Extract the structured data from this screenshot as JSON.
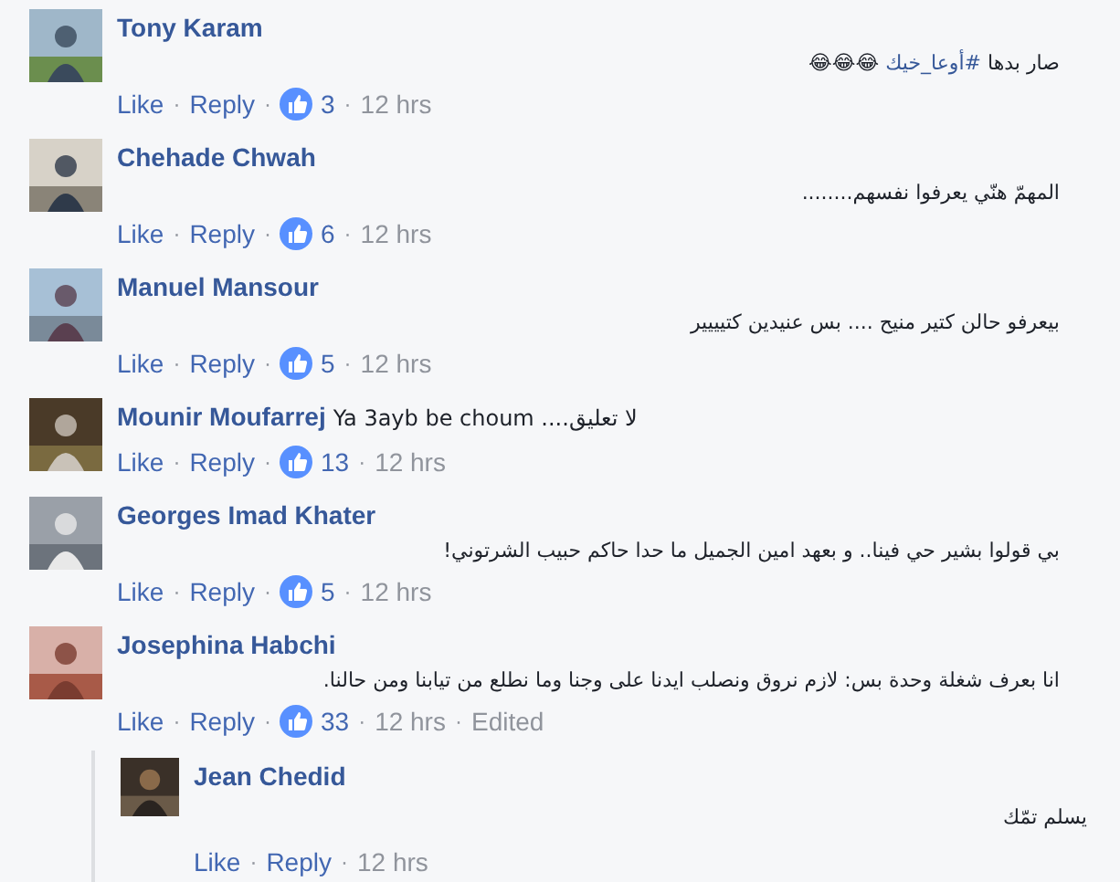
{
  "separator": "·",
  "comments": [
    {
      "name": "Tony Karam",
      "kind": "block",
      "body": [
        {
          "text": "صار بدها ",
          "link": false
        },
        {
          "text": "#أوعا_خيك",
          "link": true
        },
        {
          "text": " 😂😂😂",
          "link": false
        }
      ],
      "actions": [
        "Like",
        "Reply"
      ],
      "likes": "3",
      "time": "12 hrs"
    },
    {
      "name": "Chehade Chwah",
      "kind": "block",
      "body": [
        {
          "text": "المهمّ هنّي يعرفوا نفسهم........",
          "link": false
        }
      ],
      "actions": [
        "Like",
        "Reply"
      ],
      "likes": "6",
      "time": "12 hrs"
    },
    {
      "name": "Manuel Mansour",
      "kind": "block",
      "body": [
        {
          "text": "بيعرفو حالن كتير منيح .... بس عنيدين كتيييير",
          "link": false
        }
      ],
      "actions": [
        "Like",
        "Reply"
      ],
      "likes": "5",
      "time": "12 hrs"
    },
    {
      "name": "Mounir Moufarrej",
      "kind": "inline",
      "body": [
        {
          "text": "Ya 3ayb be choum ....لا تعليق",
          "link": false
        }
      ],
      "actions": [
        "Like",
        "Reply"
      ],
      "likes": "13",
      "time": "12 hrs"
    },
    {
      "name": "Georges Imad Khater",
      "kind": "block",
      "body": [
        {
          "text": "بي قولوا بشير حي فينا.. و بعهد امين الجميل ما حدا حاكم حبيب الشرتوني!",
          "link": false
        }
      ],
      "actions": [
        "Like",
        "Reply"
      ],
      "likes": "5",
      "time": "12 hrs"
    },
    {
      "name": "Josephina Habchi",
      "kind": "block",
      "body": [
        {
          "text": "انا بعرف شغلة وحدة بس: لازم نروق ونصلب ايدنا على وجنا وما نطلع من تيابنا ومن حالنا.",
          "link": false
        }
      ],
      "actions": [
        "Like",
        "Reply"
      ],
      "likes": "33",
      "time": "12 hrs",
      "edited": "Edited",
      "replies": [
        {
          "name": "Jean Chedid",
          "body": [
            {
              "text": "يسلم تمّك",
              "link": false
            }
          ],
          "actions": [
            "Like",
            "Reply"
          ],
          "time": "12 hrs"
        }
      ]
    }
  ]
}
